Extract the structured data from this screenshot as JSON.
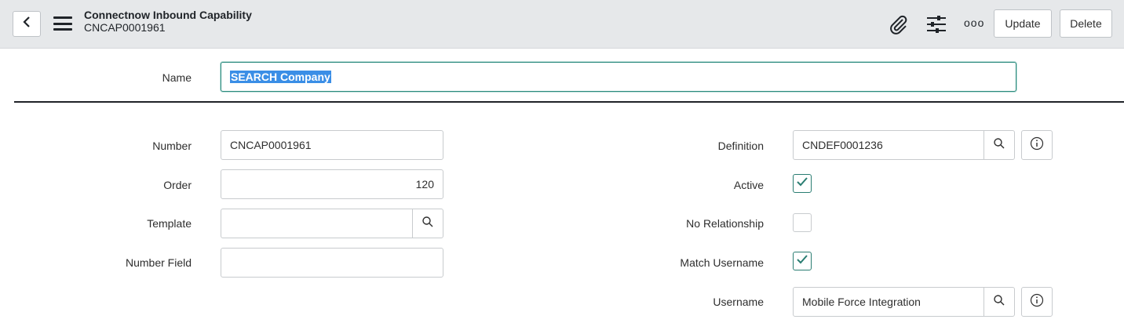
{
  "header": {
    "title": "Connectnow Inbound Capability",
    "subtitle": "CNCAP0001961",
    "back_icon": "chevron-left-icon",
    "menu_icon": "hamburger-icon",
    "attachment_icon": "paperclip-icon",
    "personalize_icon": "sliders-icon",
    "more_icon": "ellipsis-icon",
    "more_label": "ooo",
    "update_label": "Update",
    "delete_label": "Delete"
  },
  "form": {
    "name": {
      "label": "Name",
      "value": "SEARCH Company"
    },
    "number": {
      "label": "Number",
      "value": "CNCAP0001961"
    },
    "order": {
      "label": "Order",
      "value": "120"
    },
    "template": {
      "label": "Template",
      "value": ""
    },
    "number_field": {
      "label": "Number Field",
      "value": ""
    },
    "definition": {
      "label": "Definition",
      "value": "CNDEF0001236"
    },
    "active": {
      "label": "Active",
      "checked": true
    },
    "no_relationship": {
      "label": "No Relationship",
      "checked": false
    },
    "match_username": {
      "label": "Match Username",
      "checked": true
    },
    "username": {
      "label": "Username",
      "value": "Mobile Force Integration"
    }
  },
  "colors": {
    "accent": "#2a8a7d",
    "selection": "#3a8ee6",
    "header_bg": "#e6e8ea"
  }
}
